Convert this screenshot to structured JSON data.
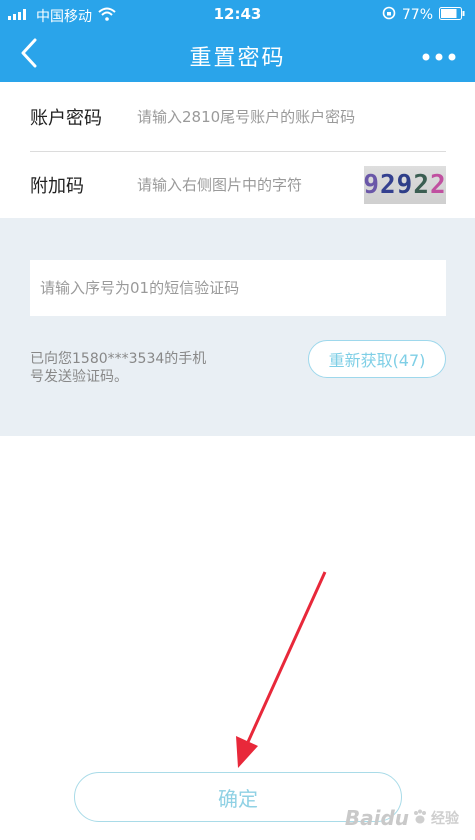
{
  "status_bar": {
    "carrier": "中国移动",
    "time": "12:43",
    "battery": "77%"
  },
  "nav": {
    "title": "重置密码"
  },
  "form": {
    "account_password": {
      "label": "账户密码",
      "placeholder": "请输入2810尾号账户的账户密码"
    },
    "extra_code": {
      "label": "附加码",
      "placeholder": "请输入右侧图片中的字符",
      "captcha_chars": [
        "9",
        "2",
        "9",
        "2",
        "2"
      ]
    }
  },
  "sms": {
    "placeholder": "请输入序号为01的短信验证码",
    "info_line1": "已向您1580***3534的手机",
    "info_line2": "号发送验证码。",
    "resend_label": "重新获取(47)"
  },
  "confirm_label": "确定",
  "watermark": {
    "text": "Baidu",
    "sub": "经验"
  },
  "colors": {
    "header_bg": "#2aa4ea",
    "panel_bg": "#e9eff4",
    "button_text": "#8fd1e4",
    "arrow": "#e8283a"
  },
  "icons": [
    "signal-icon",
    "wifi-icon",
    "rotation-lock-icon",
    "battery-icon",
    "back-chevron-icon",
    "more-dots-icon"
  ]
}
